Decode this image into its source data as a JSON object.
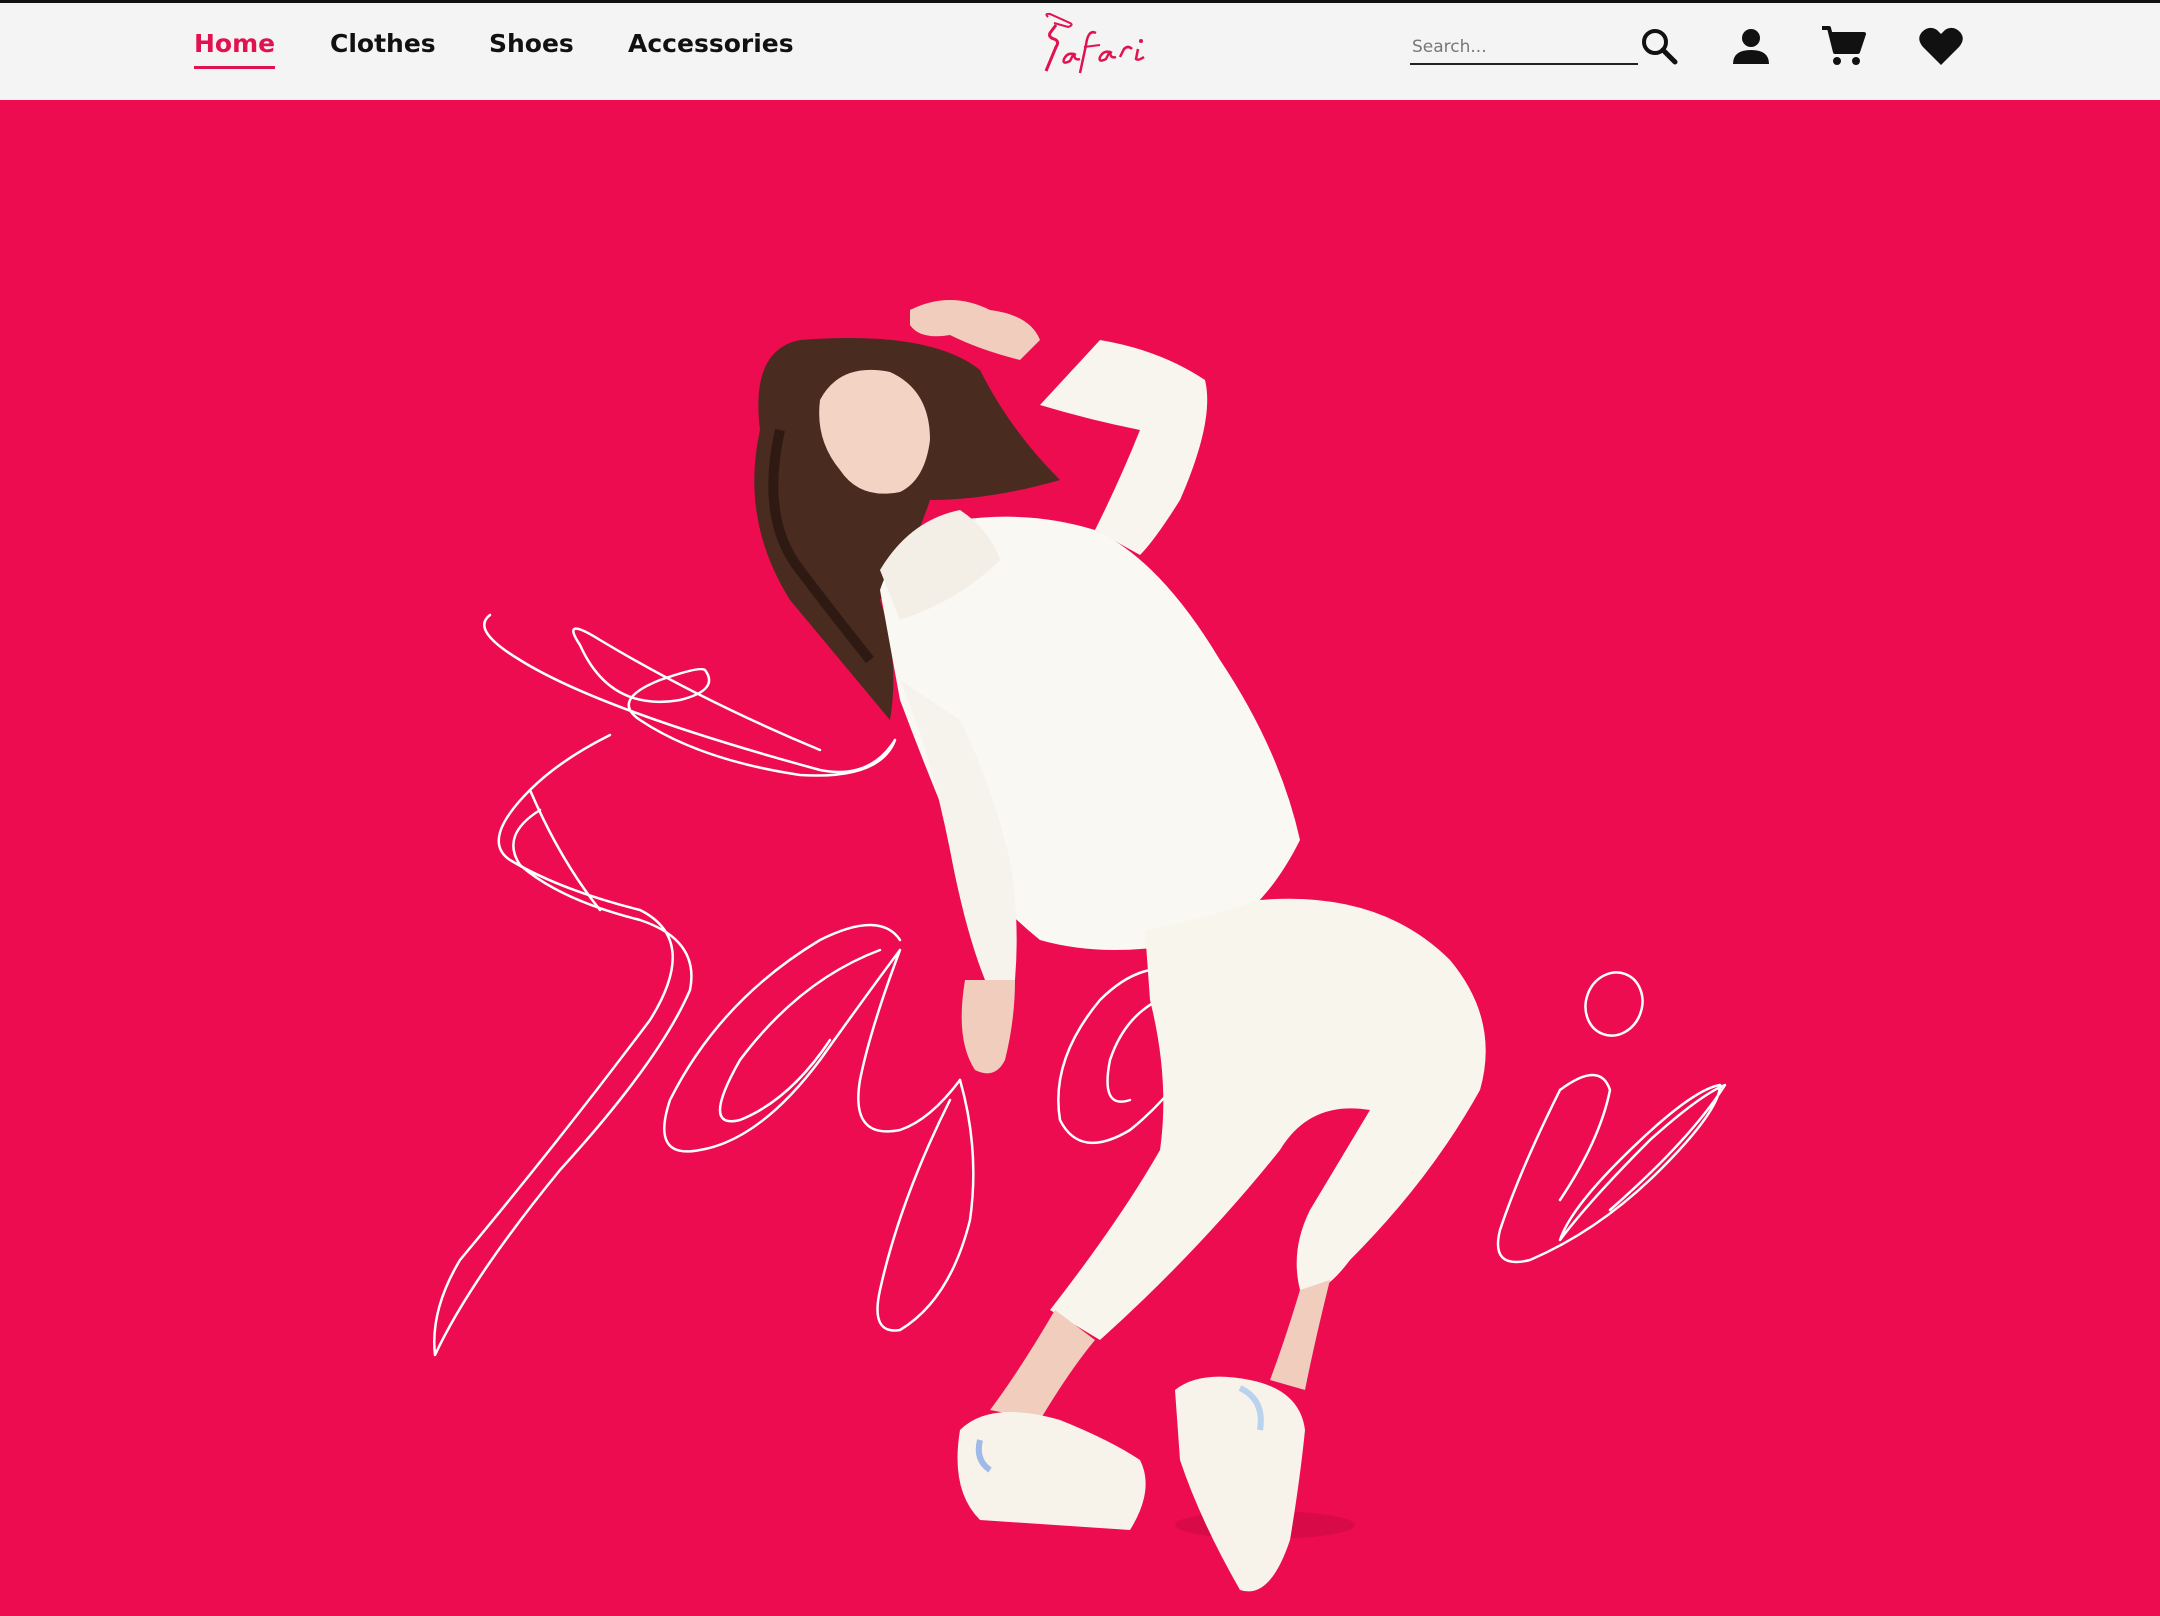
{
  "nav": {
    "links": [
      {
        "label": "Home",
        "active": true
      },
      {
        "label": "Clothes",
        "active": false
      },
      {
        "label": "Shoes",
        "active": false
      },
      {
        "label": "Accessories",
        "active": false
      }
    ]
  },
  "brand": {
    "logo_text": "Safari",
    "accent_color": "#e0124f",
    "hero_background": "#ed0c4f"
  },
  "search": {
    "placeholder": "Search..."
  },
  "icons": {
    "search": "search-icon",
    "account": "user-icon",
    "cart": "cart-icon",
    "wishlist": "heart-icon"
  },
  "hero": {
    "background_word": "Safari"
  }
}
